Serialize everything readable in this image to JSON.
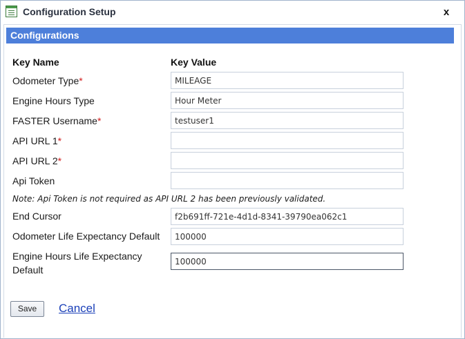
{
  "window": {
    "title": "Configuration Setup",
    "close_label": "x"
  },
  "section": {
    "title": "Configurations"
  },
  "columns": {
    "key_name": "Key Name",
    "key_value": "Key Value"
  },
  "fields": [
    {
      "label": "Odometer Type",
      "required": "*",
      "value": "MILEAGE"
    },
    {
      "label": "Engine Hours Type",
      "required": "",
      "value": "Hour Meter"
    },
    {
      "label": "FASTER Username",
      "required": "*",
      "value": "testuser1"
    },
    {
      "label": "API URL 1",
      "required": "*",
      "value": ""
    },
    {
      "label": "API URL 2",
      "required": "*",
      "value": ""
    },
    {
      "label": "Api Token",
      "required": "",
      "value": ""
    }
  ],
  "note": "Note: Api Token is not required as API URL 2 has been previously validated.",
  "extra_fields": [
    {
      "label": "End Cursor",
      "value": "f2b691ff-721e-4d1d-8341-39790ea062c1"
    },
    {
      "label": "Odometer Life Expectancy Default",
      "value": "100000"
    },
    {
      "label_line1": "Engine Hours Life Expectancy",
      "label_line2": "Default",
      "value": "100000"
    }
  ],
  "actions": {
    "save_label": "Save",
    "cancel_label": "Cancel"
  },
  "colors": {
    "section_header_bg": "#4d7fda",
    "required_marker": "#d11a1a",
    "link": "#1a3fb8"
  },
  "icons": {
    "title_icon": "form-window-icon",
    "close_icon": "close-icon"
  }
}
